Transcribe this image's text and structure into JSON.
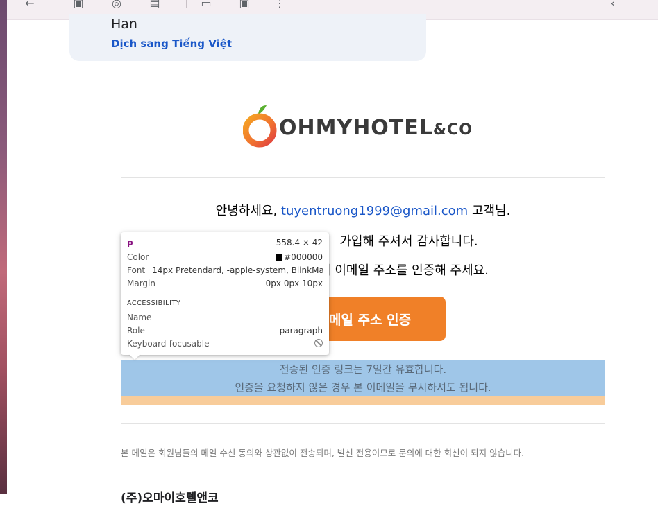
{
  "sender": {
    "name": "Han",
    "translate_link": "Dịch sang Tiếng Việt"
  },
  "toolbar": {
    "icons": [
      "back-arrow-icon",
      "archive-icon",
      "report-spam-icon",
      "delete-icon",
      "mark-unread-icon",
      "move-to-icon",
      "more-options-icon",
      "prev-icon"
    ]
  },
  "email": {
    "logo_text": "OHMYHOTEL",
    "logo_amp": "&CO",
    "greeting_prefix": "안녕하세요,",
    "greeting_email": "tuyentruong1999@gmail.com",
    "greeting_suffix": "고객님.",
    "line2": "가입해 주셔서 감사합니다.",
    "line3": "여 이메일 주소를 인증해 주세요.",
    "verify_button": "메일 주소 인증",
    "note_line1": "전송된 인증 링크는 7일간 유효합니다.",
    "note_line2": "인증을 요청하지 않은 경우 본 이메일을 무시하셔도 됩니다.",
    "footer_note": "본 메일은 회원님들의 메일 수신 동의와 상관없이 전송되며, 발신 전용이므로 문의에 대한 회신이 되지 않습니다.",
    "company": "(주)오마이호텔앤코"
  },
  "inspector": {
    "tag": "p",
    "size": "558.4 × 42",
    "color_label": "Color",
    "color_value": "#000000",
    "font_label": "Font",
    "font_value": "14px Pretendard, -apple-system, BlinkMa...",
    "margin_label": "Margin",
    "margin_value": "0px 0px 10px",
    "section": "ACCESSIBILITY",
    "name_label": "Name",
    "role_label": "Role",
    "role_value": "paragraph",
    "focus_label": "Keyboard-focusable"
  },
  "colors": {
    "accent": "#f08028",
    "link": "#1a57c8",
    "highlight_content": "#9fc6e8",
    "highlight_margin": "#f8cc9a"
  }
}
